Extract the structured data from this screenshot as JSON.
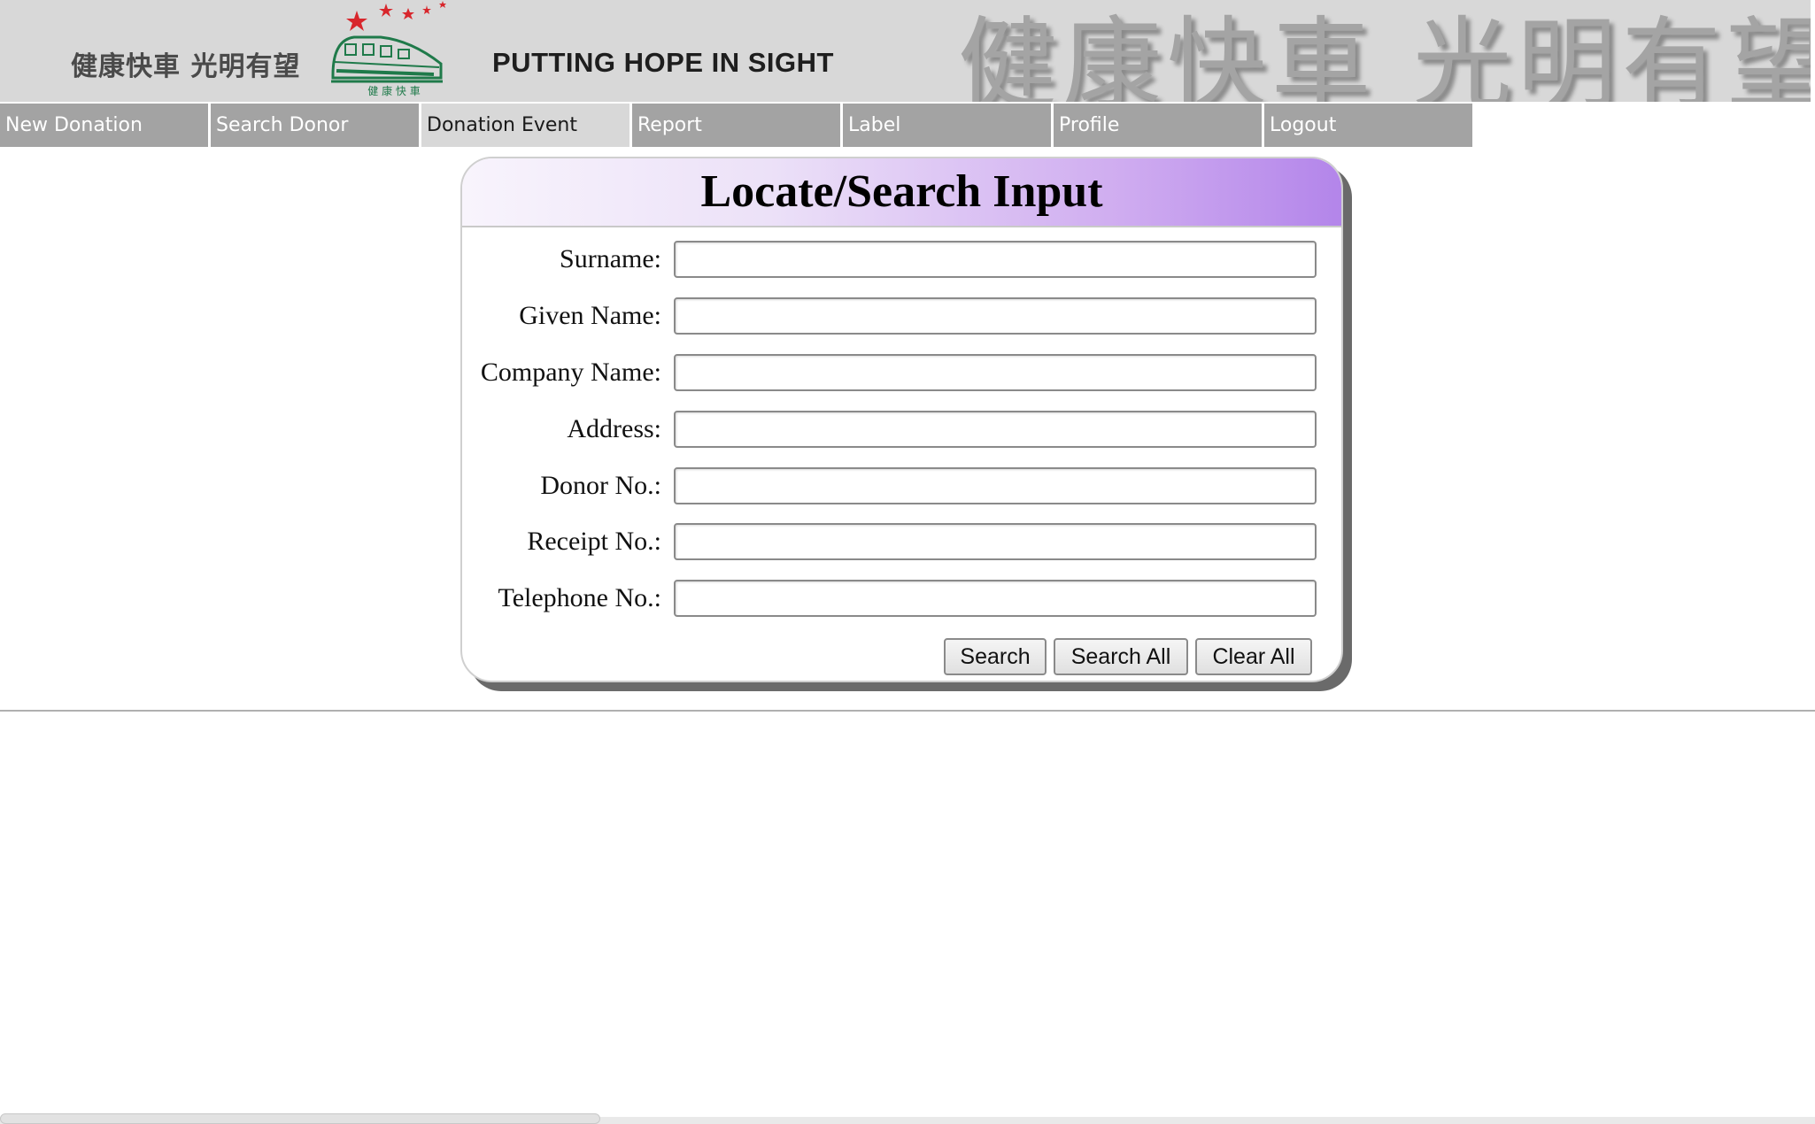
{
  "banner": {
    "slogan_small": "健康快車 光明有望",
    "tagline": "PUTTING HOPE IN SIGHT",
    "slogan_big": "健康快車 光明有望",
    "logo_caption": "健 康 快 車",
    "colors": {
      "banner_bg": "#d8d8d8",
      "star_red": "#d8262c",
      "train_green": "#1f7a4a"
    }
  },
  "nav": {
    "items": [
      {
        "label": "New Donation",
        "active": false
      },
      {
        "label": "Search Donor",
        "active": false
      },
      {
        "label": "Donation Event",
        "active": true
      },
      {
        "label": "Report",
        "active": false
      },
      {
        "label": "Label",
        "active": false
      },
      {
        "label": "Profile",
        "active": false
      },
      {
        "label": "Logout",
        "active": false
      }
    ]
  },
  "search_panel": {
    "title": "Locate/Search Input",
    "fields": [
      {
        "label": "Surname:",
        "value": ""
      },
      {
        "label": "Given Name:",
        "value": ""
      },
      {
        "label": "Company Name:",
        "value": ""
      },
      {
        "label": "Address:",
        "value": ""
      },
      {
        "label": "Donor No.:",
        "value": ""
      },
      {
        "label": "Receipt No.:",
        "value": ""
      },
      {
        "label": "Telephone No.:",
        "value": ""
      }
    ],
    "buttons": {
      "search": "Search",
      "search_all": "Search All",
      "clear_all": "Clear All"
    },
    "colors": {
      "header_gradient_start": "#f8f4fc",
      "header_gradient_end": "#b385ea"
    }
  }
}
